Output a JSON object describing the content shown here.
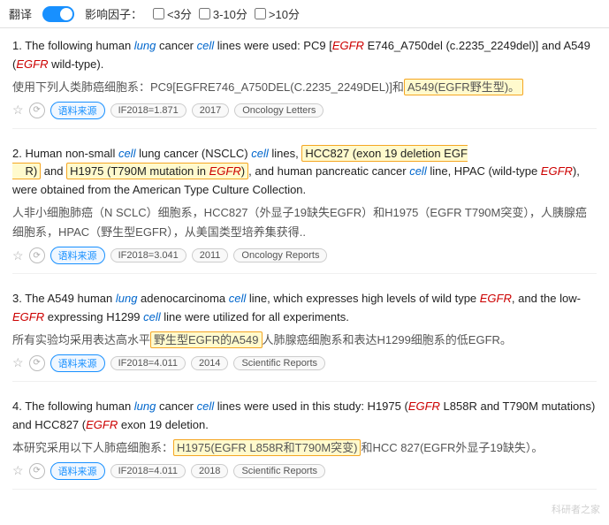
{
  "topbar": {
    "toggle_label": "翻译",
    "filter_label": "影响因子：",
    "filters": [
      {
        "label": "<3分",
        "checked": false
      },
      {
        "label": "3-10分",
        "checked": false
      },
      {
        "label": ">10分",
        "checked": false
      }
    ]
  },
  "results": [
    {
      "number": "1.",
      "en_parts": [
        {
          "text": "The following human "
        },
        {
          "text": "lung",
          "style": "italic-blue"
        },
        {
          "text": " cancer "
        },
        {
          "text": "cell",
          "style": "italic-blue"
        },
        {
          "text": " lines were used: PC9 ["
        },
        {
          "text": "EGFR",
          "style": "italic-red"
        },
        {
          "text": " E746_A750del (c.2235_2249del)] and A549 ("
        },
        {
          "text": "EGFR",
          "style": "italic-red"
        },
        {
          "text": " wild-type)."
        }
      ],
      "cn_parts": [
        {
          "text": "使用下列人类肺癌细胞系：PC9[EGFRE746_A750DEL(C.2235_2249DEL)]和"
        },
        {
          "text": "A549(EGFR野生型)。",
          "highlight": true
        }
      ],
      "if_value": "IF2018=1.871",
      "year": "2017",
      "journal": "Oncology Letters"
    },
    {
      "number": "2.",
      "en_parts": [
        {
          "text": "Human non-small "
        },
        {
          "text": "cell",
          "style": "italic-blue"
        },
        {
          "text": " lung cancer (NSCLC) "
        },
        {
          "text": "cell",
          "style": "italic-blue"
        },
        {
          "text": " lines, "
        },
        {
          "text": "HCC827 (exon 19 deletion EGF R)",
          "highlight": true
        },
        {
          "text": " and "
        },
        {
          "text": "H1975 (T790M mutation in EGFR)",
          "highlight": true
        },
        {
          "text": ", and human pancreatic cancer "
        },
        {
          "text": "cell",
          "style": "italic-blue"
        },
        {
          "text": " line, HPAC (wild-type "
        },
        {
          "text": "EGFR",
          "style": "italic-red"
        },
        {
          "text": "), were obtained from the American Type Culture Collection."
        }
      ],
      "cn_parts": [
        {
          "text": "人非小细胞肺癌（N SCLC）细胞系，HCC827（外显子19缺失EGFR）和H1975（EGFR T790M突变），人胰腺癌细胞系，HPAC（野生型EGFR），从美国类型培养集获得.."
        }
      ],
      "if_value": "IF2018=3.041",
      "year": "2011",
      "journal": "Oncology Reports"
    },
    {
      "number": "3.",
      "en_parts": [
        {
          "text": "The A549 human "
        },
        {
          "text": "lung",
          "style": "italic-blue"
        },
        {
          "text": " adenocarcinoma "
        },
        {
          "text": "cell",
          "style": "italic-blue"
        },
        {
          "text": " line, which expresses high levels of wild type "
        },
        {
          "text": "EGFR",
          "style": "italic-red"
        },
        {
          "text": ", and the low-"
        },
        {
          "text": "EGFR",
          "style": "italic-red"
        },
        {
          "text": " expressing H1299 "
        },
        {
          "text": "cell",
          "style": "italic-blue"
        },
        {
          "text": " line were utilized for all experiments."
        }
      ],
      "cn_parts": [
        {
          "text": "所有实验均采用表达高水平"
        },
        {
          "text": "野生型EGFR的A549",
          "highlight": true
        },
        {
          "text": "人肺腺癌细胞系和表达H1299细胞系的低EGFR。"
        }
      ],
      "if_value": "IF2018=4.011",
      "year": "2014",
      "journal": "Scientific Reports"
    },
    {
      "number": "4.",
      "en_parts": [
        {
          "text": "The following human "
        },
        {
          "text": "lung",
          "style": "italic-blue"
        },
        {
          "text": " cancer "
        },
        {
          "text": "cell",
          "style": "italic-blue"
        },
        {
          "text": " lines were used in this study: H1975 ("
        },
        {
          "text": "EGFR",
          "style": "italic-red"
        },
        {
          "text": " L858R and T790M mutations) and HCC827 ("
        },
        {
          "text": "EGFR",
          "style": "italic-red"
        },
        {
          "text": " exon 19 deletion."
        }
      ],
      "cn_parts": [
        {
          "text": "本研究采用以下人肺癌细胞系："
        },
        {
          "text": "H1975(EGFR L858R和T790M突变)",
          "highlight": true
        },
        {
          "text": "和HCC 827(EGFR外显子19缺失）。"
        }
      ],
      "if_value": "IF2018=4.011",
      "year": "2018",
      "journal": "Scientific Reports"
    }
  ],
  "watermark": "科研者之家"
}
